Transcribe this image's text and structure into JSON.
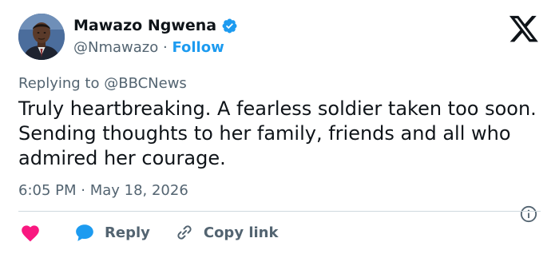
{
  "author": {
    "name": "Mawazo Ngwena",
    "handle": "@Nmawazo",
    "separator": "·",
    "follow_label": "Follow",
    "verified_icon": "verified-badge-icon",
    "avatar_icon": "profile-photo"
  },
  "platform_logo": "x-logo-icon",
  "reply_context": {
    "prefix": "Replying to",
    "mention": "@BBCNews"
  },
  "tweet": {
    "text": "Truly heartbreaking. A fearless soldier taken too soon. Sending thoughts to her family, friends and all who admired her courage.",
    "timestamp": "6:05 PM · May 18, 2026"
  },
  "actions": {
    "like_icon": "heart-icon",
    "reply_label": "Reply",
    "reply_icon": "speech-bubble-icon",
    "copy_label": "Copy link",
    "copy_icon": "link-icon",
    "info_icon": "info-icon"
  },
  "colors": {
    "text": "#0f1419",
    "secondary": "#536471",
    "accent": "#1d9bf0",
    "like": "#f91880",
    "divider": "#cfd9de"
  }
}
